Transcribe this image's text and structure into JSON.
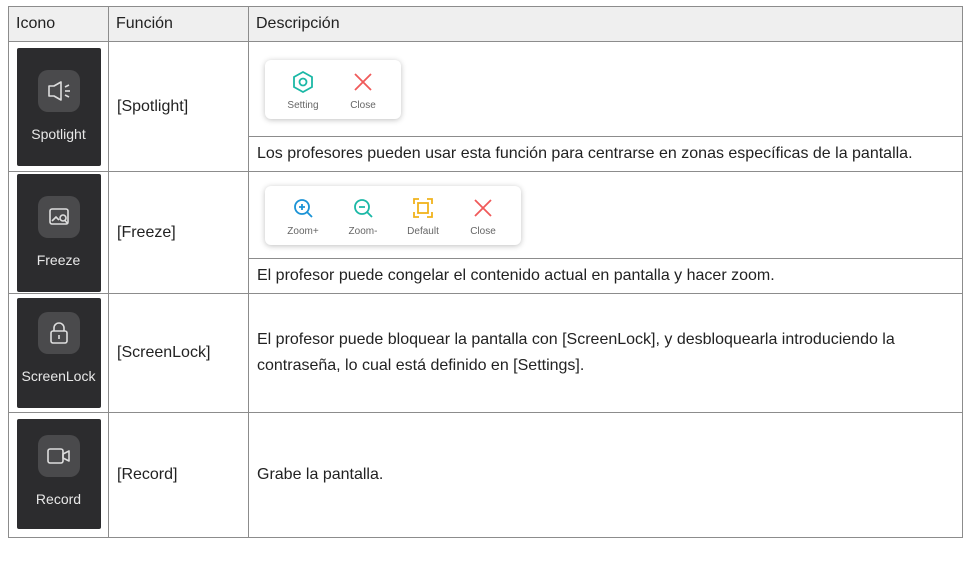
{
  "headers": [
    "Icono",
    "Función",
    "Descripción"
  ],
  "rows": [
    {
      "icon_name": "spotlight-icon",
      "icon_label": "Spotlight",
      "function": "[Spotlight]",
      "toolbar": [
        {
          "icon": "setting-icon",
          "label": "Setting",
          "color": "#1bb8a6"
        },
        {
          "icon": "close-icon",
          "label": "Close",
          "color": "#f05a5a"
        }
      ],
      "description": "Los profesores pueden usar esta función para centrarse en zonas específicas de la pantalla."
    },
    {
      "icon_name": "freeze-icon",
      "icon_label": "Freeze",
      "function": "[Freeze]",
      "toolbar": [
        {
          "icon": "zoom-in-icon",
          "label": "Zoom+",
          "color": "#1b93d6"
        },
        {
          "icon": "zoom-out-icon",
          "label": "Zoom-",
          "color": "#1bb8a6"
        },
        {
          "icon": "default-icon",
          "label": "Default",
          "color": "#f0b21b"
        },
        {
          "icon": "close-icon",
          "label": "Close",
          "color": "#f05a5a"
        }
      ],
      "description": "El profesor puede congelar el contenido actual en pantalla y hacer zoom."
    },
    {
      "icon_name": "lock-icon",
      "icon_label": "ScreenLock",
      "function": "[ScreenLock]",
      "description": "El profesor puede bloquear la pantalla con [ScreenLock], y desbloquearla introduciendo la contraseña, lo cual está definido en [Settings]."
    },
    {
      "icon_name": "record-icon",
      "icon_label": "Record",
      "function": "[Record]",
      "description": "Grabe la pantalla."
    }
  ]
}
